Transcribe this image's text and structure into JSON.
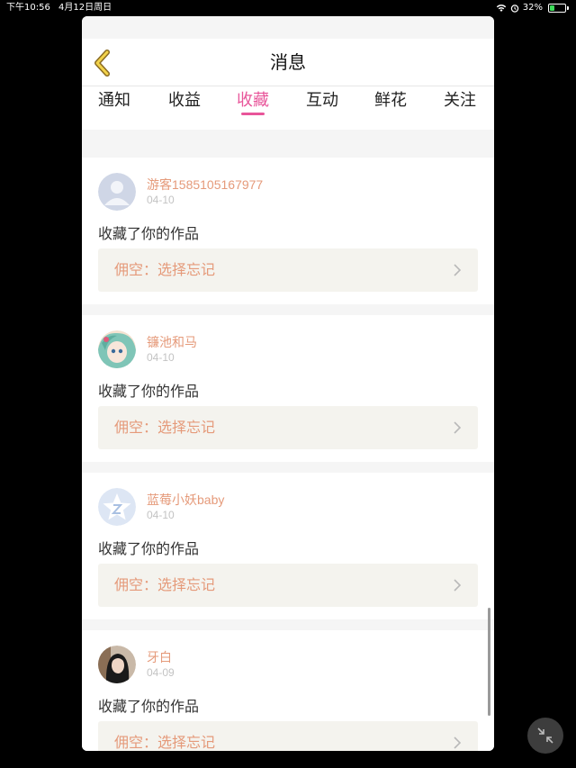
{
  "status_bar": {
    "time": "下午10:56",
    "date": "4月12日周日",
    "battery": "32%",
    "battery_level": 0.32
  },
  "nav": {
    "title": "消息"
  },
  "tabs": [
    {
      "label": "通知",
      "active": false
    },
    {
      "label": "收益",
      "active": false
    },
    {
      "label": "收藏",
      "active": true
    },
    {
      "label": "互动",
      "active": false
    },
    {
      "label": "鲜花",
      "active": false
    },
    {
      "label": "关注",
      "active": false
    }
  ],
  "messages": [
    {
      "username": "游客1585105167977",
      "date": "04-10",
      "action": "收藏了你的作品",
      "work": "佣空：选择忘记",
      "avatar": "default-avatar-icon"
    },
    {
      "username": "镰池和马",
      "date": "04-10",
      "action": "收藏了你的作品",
      "work": "佣空：选择忘记",
      "avatar": "anime-avatar"
    },
    {
      "username": "蓝莓小妖baby",
      "date": "04-10",
      "action": "收藏了你的作品",
      "work": "佣空：选择忘记",
      "avatar": "star-avatar-icon"
    },
    {
      "username": "牙白",
      "date": "04-09",
      "action": "收藏了你的作品",
      "work": "佣空：选择忘记",
      "avatar": "photo-avatar"
    }
  ],
  "colors": {
    "accent": "#e8559a",
    "username": "#e59a7a",
    "work_box_bg": "#f4f3ee"
  }
}
